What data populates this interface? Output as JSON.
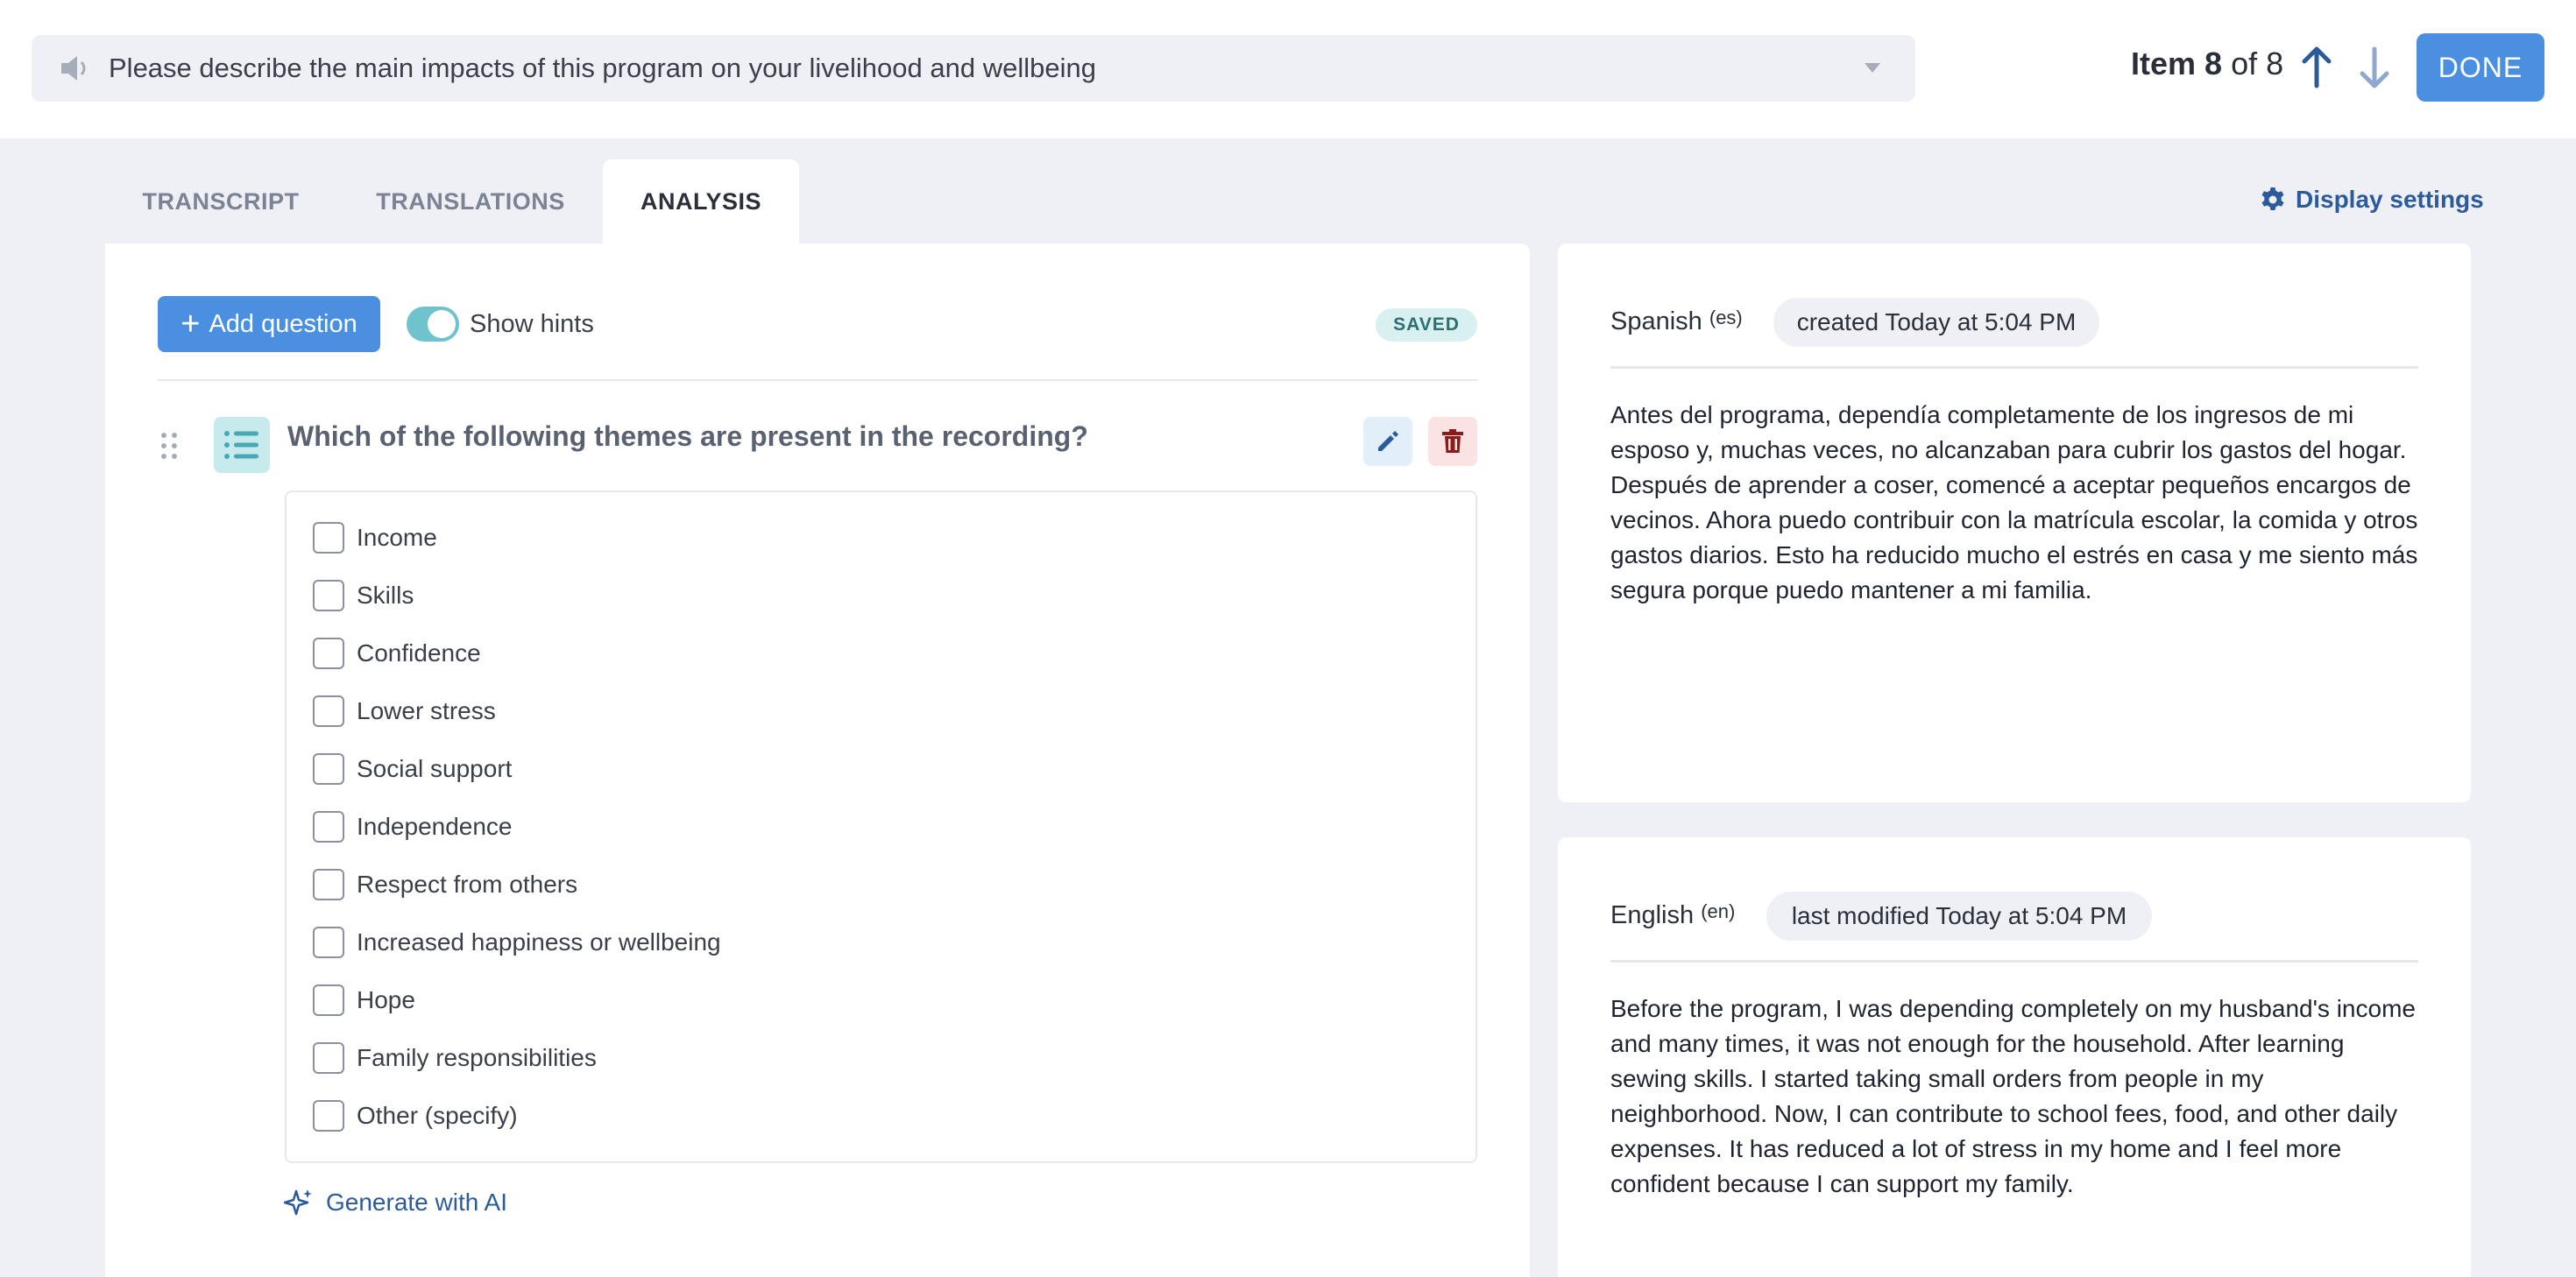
{
  "header": {
    "question_text": "Please describe the main impacts of this program on your livelihood and wellbeing",
    "item_prefix": "Item",
    "item_current": "8",
    "item_of": "of 8",
    "done_label": "DONE"
  },
  "tabs": [
    {
      "label": "TRANSCRIPT",
      "active": false
    },
    {
      "label": "TRANSLATIONS",
      "active": false
    },
    {
      "label": "ANALYSIS",
      "active": true
    }
  ],
  "display_settings_label": "Display settings",
  "analysis": {
    "add_question_label": "Add question",
    "show_hints_label": "Show hints",
    "show_hints_on": true,
    "saved_label": "SAVED",
    "question_title": "Which of the following themes are present in the recording?",
    "options": [
      "Income",
      "Skills",
      "Confidence",
      "Lower stress",
      "Social support",
      "Independence",
      "Respect from others",
      "Increased happiness or wellbeing",
      "Hope",
      "Family responsibilities",
      "Other (specify)"
    ],
    "generate_ai_label": "Generate with AI"
  },
  "transcript_card": {
    "language": "Spanish",
    "code": "(es)",
    "status": "created Today at 5:04 PM",
    "text": "Antes del programa, dependía completamente de los ingresos de mi esposo y, muchas veces, no alcanzaban para cubrir los gastos del hogar. Después de aprender a coser, comencé a aceptar pequeños encargos de vecinos. Ahora puedo contribuir con la matrícula escolar, la comida y otros gastos diarios. Esto ha reducido mucho el estrés en casa y me siento más segura porque puedo mantener a mi familia."
  },
  "translation_card": {
    "language": "English",
    "code": "(en)",
    "status": "last modified Today at 5:04 PM",
    "text": "Before the program, I was depending completely on my husband's income and many times, it was not enough for the household. After learning sewing skills. I started taking small orders from people in my neighborhood. Now, I can contribute to school fees, food, and other daily expenses. It has reduced a lot of stress in my home and I feel more confident because I can support my family."
  },
  "colors": {
    "primary": "#4a8fe0",
    "link": "#2c5b9c",
    "toggle": "#6fc3cc",
    "delete": "#8b1c1c",
    "background": "#eef0f5"
  }
}
